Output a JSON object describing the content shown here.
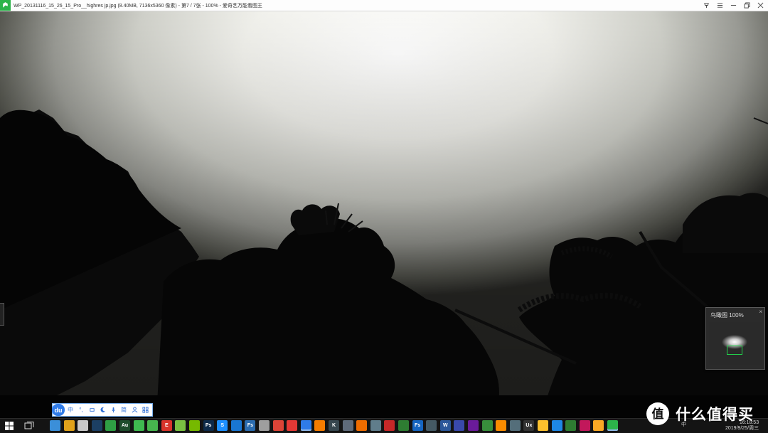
{
  "titlebar": {
    "title": "WP_20131116_15_26_15_Pro__highres jp.jpg (8.40MB, 7136x5360 像素) - 第7 / 7张 - 100% - 爱奇艺万能看图王",
    "icons": [
      "app-logo-icon",
      "pin-icon",
      "menu-icon",
      "minimize-icon",
      "restore-icon",
      "close-icon"
    ]
  },
  "navigator": {
    "title": "鸟瞰图  100%",
    "close": "×"
  },
  "ime": {
    "logo": "du",
    "items": [
      "中",
      "°,",
      "skin",
      "moon",
      "mic",
      "简",
      "user",
      "grid"
    ],
    "labels": {
      "lang": "中",
      "simplified": "简"
    }
  },
  "taskbar": {
    "apps": [
      {
        "name": "start",
        "label": ""
      },
      {
        "name": "task-view",
        "label": ""
      },
      {
        "name": "app-blue",
        "label": "",
        "color": "#3b8fd9"
      },
      {
        "name": "app-yellow",
        "label": "",
        "color": "#e0a21b"
      },
      {
        "name": "app-calendar",
        "label": "",
        "color": "#c9c9c9"
      },
      {
        "name": "app-steam",
        "label": "",
        "color": "#1c3f63"
      },
      {
        "name": "app-globe",
        "label": "",
        "color": "#2f9e44"
      },
      {
        "name": "app-audition",
        "label": "Au",
        "color": "#1d4d2c"
      },
      {
        "name": "app-wechat",
        "label": "",
        "color": "#3fb950"
      },
      {
        "name": "app-green-circle",
        "label": "",
        "color": "#47b54e"
      },
      {
        "name": "app-e",
        "label": "E",
        "color": "#d9342b"
      },
      {
        "name": "app-parrot",
        "label": "",
        "color": "#7ac142"
      },
      {
        "name": "app-nvidia",
        "label": "",
        "color": "#76b900"
      },
      {
        "name": "app-photoshop",
        "label": "Ps",
        "color": "#0d2a4a"
      },
      {
        "name": "app-s",
        "label": "S",
        "color": "#1e90ff"
      },
      {
        "name": "app-play",
        "label": "",
        "color": "#1976d2"
      },
      {
        "name": "app-fs",
        "label": "Fs",
        "color": "#2b6cb0"
      },
      {
        "name": "app-cat",
        "label": "",
        "color": "#9e9e9e"
      },
      {
        "name": "app-chrome",
        "label": "",
        "color": "#db4437"
      },
      {
        "name": "app-netease",
        "label": "",
        "color": "#e53935"
      },
      {
        "name": "app-baidu",
        "label": "",
        "color": "#2f7be8"
      },
      {
        "name": "app-orange",
        "label": "",
        "color": "#f57c00"
      },
      {
        "name": "app-k",
        "label": "K",
        "color": "#37474f"
      },
      {
        "name": "app-gray",
        "label": "",
        "color": "#5f6b7a"
      },
      {
        "name": "app-orange2",
        "label": "",
        "color": "#ef6c00"
      },
      {
        "name": "app-sheet",
        "label": "",
        "color": "#607d8b"
      },
      {
        "name": "app-red",
        "label": "",
        "color": "#c62828"
      },
      {
        "name": "app-wechat2",
        "label": "",
        "color": "#2e7d32"
      },
      {
        "name": "app-fs2",
        "label": "Fs",
        "color": "#1565c0"
      },
      {
        "name": "app-files",
        "label": "",
        "color": "#455a64"
      },
      {
        "name": "app-word",
        "label": "W",
        "color": "#2b579a"
      },
      {
        "name": "app-photos",
        "label": "",
        "color": "#3949ab"
      },
      {
        "name": "app-vs",
        "label": "",
        "color": "#6a1b9a"
      },
      {
        "name": "app-globe2",
        "label": "",
        "color": "#388e3c"
      },
      {
        "name": "app-orange3",
        "label": "",
        "color": "#fb8c00"
      },
      {
        "name": "app-gallery",
        "label": "",
        "color": "#546e7a"
      },
      {
        "name": "app-u",
        "label": "Ux",
        "color": "#333333"
      },
      {
        "name": "app-chrome2",
        "label": "",
        "color": "#fbc02d"
      },
      {
        "name": "app-feather",
        "label": "",
        "color": "#1e88e5"
      },
      {
        "name": "app-evernote",
        "label": "",
        "color": "#2e7d32"
      },
      {
        "name": "app-arrow",
        "label": "",
        "color": "#c2185b"
      },
      {
        "name": "app-explorer",
        "label": "",
        "color": "#f9a825"
      },
      {
        "name": "app-viewer",
        "label": "",
        "color": "#2cb34a"
      }
    ],
    "tray": {
      "lang": "中",
      "time": "16:18:53",
      "date": "2019/9/25/周三"
    }
  },
  "watermark": {
    "text": "什么值得买",
    "logo": "值"
  }
}
